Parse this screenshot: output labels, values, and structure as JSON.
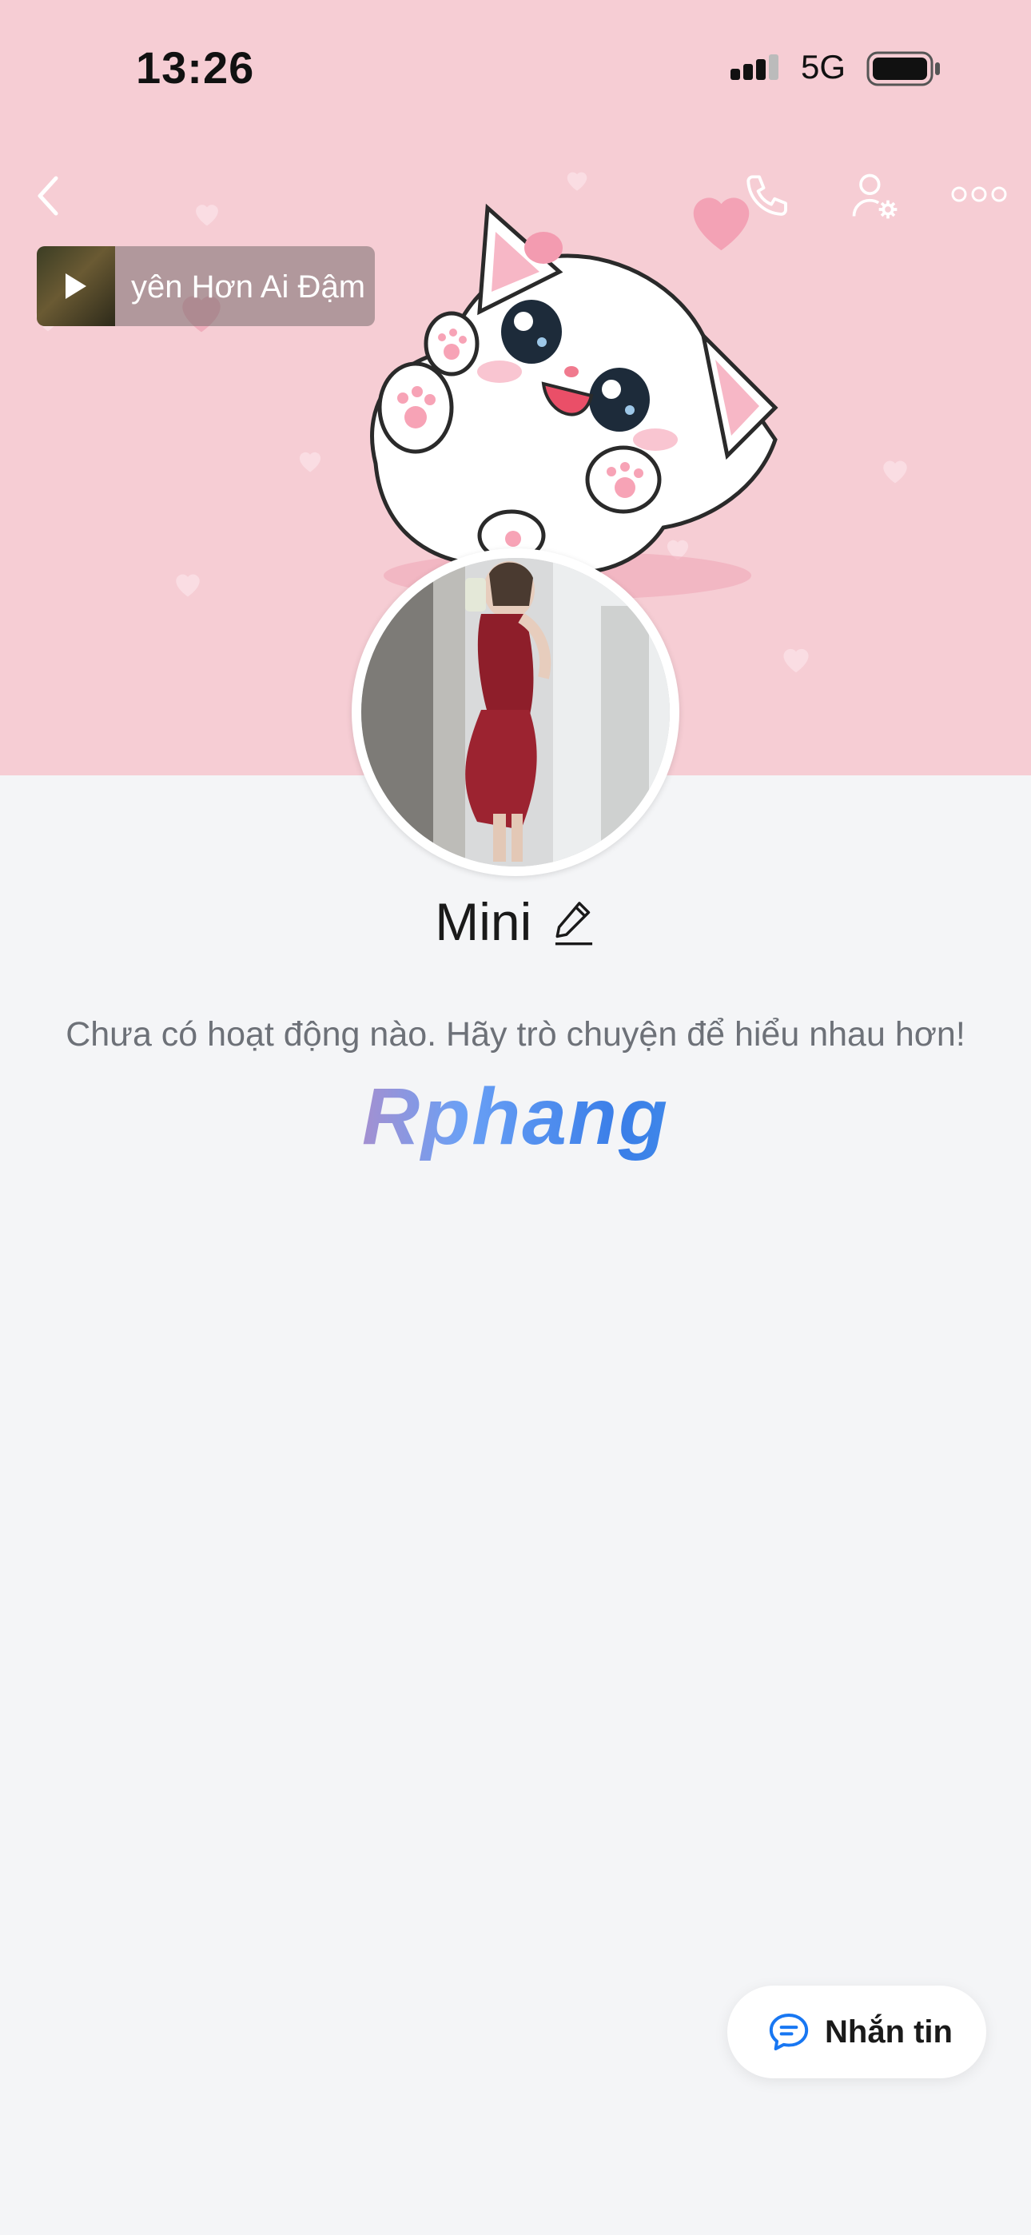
{
  "status_bar": {
    "time": "13:26",
    "network": "5G"
  },
  "header": {
    "back_icon": "chevron-left-icon",
    "call_icon": "phone-icon",
    "settings_icon": "user-settings-icon",
    "more_icon": "more-horizontal-icon"
  },
  "music": {
    "title": "yên Hơn Ai Đậm"
  },
  "profile": {
    "name": "Mini",
    "edit_icon": "pencil-icon",
    "empty_message": "Chưa có hoạt động nào. Hãy trò chuyện để hiểu nhau hơn!",
    "watermark": "Rphang"
  },
  "message_button": {
    "label": "Nhắn tin",
    "icon": "chat-bubble-icon"
  },
  "colors": {
    "cover_bg": "#f6cdd4",
    "page_bg": "#f4f5f7",
    "accent": "#1877f2"
  }
}
